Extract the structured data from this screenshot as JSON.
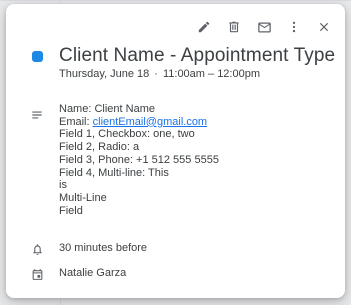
{
  "event": {
    "title": "Client Name - Appointment Type",
    "date": "Thursday, June 18",
    "separator": "·",
    "time_range": "11:00am – 12:00pm",
    "color": "#1e88e5"
  },
  "toolbar": {
    "edit_icon": "pencil-icon",
    "delete_icon": "trash-icon",
    "email_icon": "envelope-icon",
    "more_icon": "more-vert-icon",
    "close_icon": "close-icon"
  },
  "description": {
    "icon": "subject-lines-icon",
    "name_line": "Name: Client Name",
    "email_prefix": "Email: ",
    "email_link": "clientEmail@gmail.com",
    "field1": "Field 1, Checkbox: one, two",
    "field2": "Field 2, Radio: a",
    "field3": "Field 3, Phone: +1 512 555 5555",
    "field4_line1": "Field 4, Multi-line: This",
    "field4_line2": "is",
    "field4_line3": "Multi-Line",
    "field4_line4": "Field"
  },
  "reminder": {
    "icon": "bell-icon",
    "text": "30 minutes before"
  },
  "calendar": {
    "icon": "calendar-icon",
    "owner": "Natalie Garza"
  }
}
